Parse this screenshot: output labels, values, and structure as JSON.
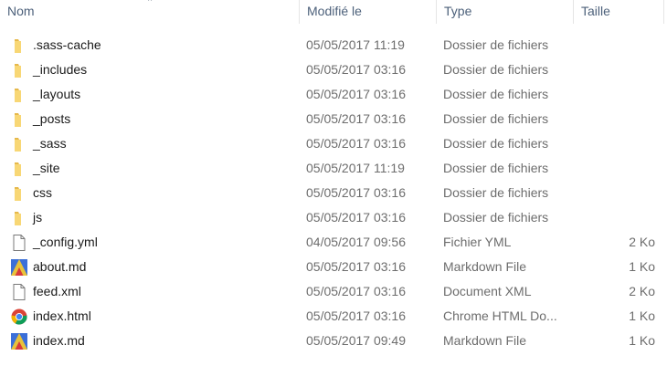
{
  "columns": {
    "name": "Nom",
    "modified": "Modifié le",
    "type": "Type",
    "size": "Taille"
  },
  "files": [
    {
      "name": ".sass-cache",
      "modified": "05/05/2017 11:19",
      "type": "Dossier de fichiers",
      "size": "",
      "icon": "folder-icon"
    },
    {
      "name": "_includes",
      "modified": "05/05/2017 03:16",
      "type": "Dossier de fichiers",
      "size": "",
      "icon": "folder-icon"
    },
    {
      "name": "_layouts",
      "modified": "05/05/2017 03:16",
      "type": "Dossier de fichiers",
      "size": "",
      "icon": "folder-icon"
    },
    {
      "name": "_posts",
      "modified": "05/05/2017 03:16",
      "type": "Dossier de fichiers",
      "size": "",
      "icon": "folder-icon"
    },
    {
      "name": "_sass",
      "modified": "05/05/2017 03:16",
      "type": "Dossier de fichiers",
      "size": "",
      "icon": "folder-icon"
    },
    {
      "name": "_site",
      "modified": "05/05/2017 11:19",
      "type": "Dossier de fichiers",
      "size": "",
      "icon": "folder-icon"
    },
    {
      "name": "css",
      "modified": "05/05/2017 03:16",
      "type": "Dossier de fichiers",
      "size": "",
      "icon": "folder-icon"
    },
    {
      "name": "js",
      "modified": "05/05/2017 03:16",
      "type": "Dossier de fichiers",
      "size": "",
      "icon": "folder-icon"
    },
    {
      "name": "_config.yml",
      "modified": "04/05/2017 09:56",
      "type": "Fichier YML",
      "size": "2 Ko",
      "icon": "document-icon"
    },
    {
      "name": "about.md",
      "modified": "05/05/2017 03:16",
      "type": "Markdown File",
      "size": "1 Ko",
      "icon": "markdown-file-icon"
    },
    {
      "name": "feed.xml",
      "modified": "05/05/2017 03:16",
      "type": "Document XML",
      "size": "2 Ko",
      "icon": "document-icon"
    },
    {
      "name": "index.html",
      "modified": "05/05/2017 03:16",
      "type": "Chrome HTML Do...",
      "size": "1 Ko",
      "icon": "chrome-icon"
    },
    {
      "name": "index.md",
      "modified": "05/05/2017 09:49",
      "type": "Markdown File",
      "size": "1 Ko",
      "icon": "markdown-file-icon"
    }
  ],
  "colors": {
    "header_text": "#4c607a",
    "folder": "#f8d775",
    "folder_dark": "#e6b84a",
    "detail_text": "#6d6d6d"
  }
}
